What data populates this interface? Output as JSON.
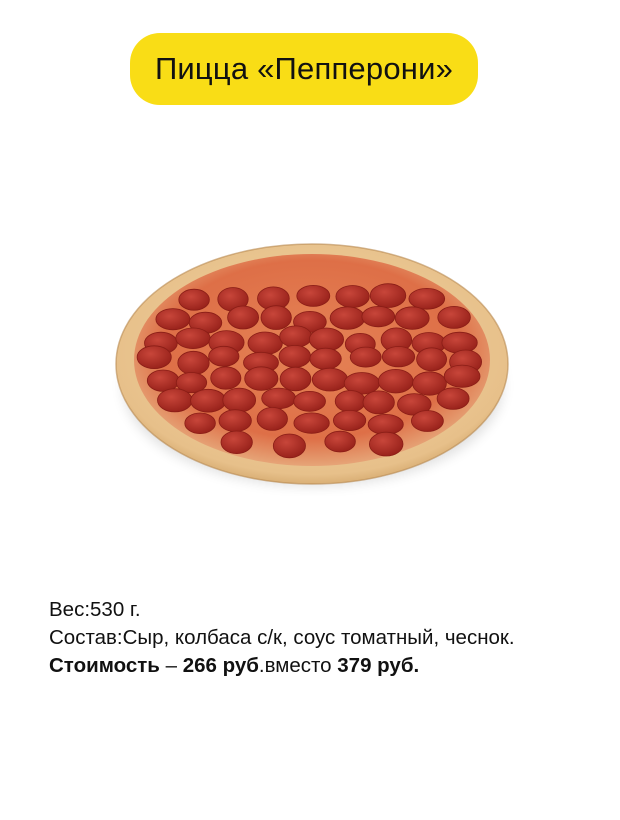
{
  "header": {
    "title": "Пицца «Пепперони»",
    "pill_color": "#f9dd16"
  },
  "product_image": {
    "icon": "pepperoni-pizza-icon",
    "crust_color": "#e9c690",
    "sauce_color": "#d85e40",
    "pepperoni_color": "#b52a22"
  },
  "details": {
    "weight_label": "Вес",
    "weight_value": ":530 г.",
    "composition_label": "Состав",
    "composition_value": ":Сыр, колбаса с/к, соус томатный, чеснок.",
    "price_label": "Стоимость",
    "price_dash": " – ",
    "price_new": "266 руб",
    "price_middle": ".вместо ",
    "price_old": "379 руб."
  }
}
